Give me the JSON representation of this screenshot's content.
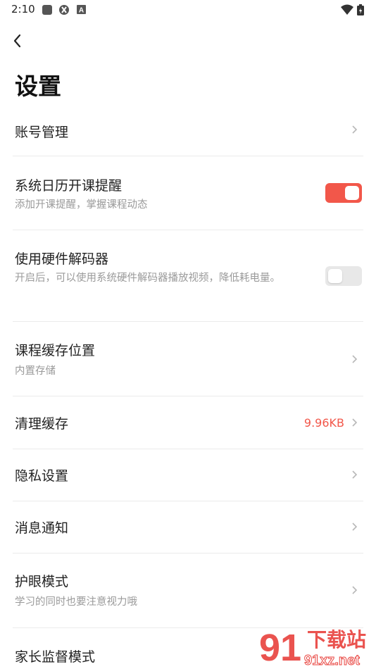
{
  "status_bar": {
    "time": "2:10",
    "left_icons": [
      "square-icon",
      "gesture-icon",
      "a-icon"
    ],
    "right_icons": [
      "wifi-icon",
      "battery-icon"
    ]
  },
  "header": {
    "back_icon": "chevron-left-icon",
    "title": "设置"
  },
  "settings": {
    "account": {
      "title": "账号管理"
    },
    "calendar_reminder": {
      "title": "系统日历开课提醒",
      "subtitle": "添加开课提醒，掌握课程动态",
      "enabled": true
    },
    "hardware_decoder": {
      "title": "使用硬件解码器",
      "subtitle": "开启后，可以使用系统硬件解码器播放视频，降低耗电量。",
      "enabled": false
    },
    "cache_location": {
      "title": "课程缓存位置",
      "subtitle": "内置存储"
    },
    "clear_cache": {
      "title": "清理缓存",
      "value": "9.96KB"
    },
    "privacy": {
      "title": "隐私设置"
    },
    "notifications": {
      "title": "消息通知"
    },
    "eye_care": {
      "title": "护眼模式",
      "subtitle": "学习的同时也要注意视力哦"
    },
    "parental": {
      "title": "家长监督模式"
    }
  },
  "watermark": {
    "text": "下载站",
    "url_text": "91xz.net"
  },
  "colors": {
    "accent": "#f2574a",
    "subtitle": "#9a9a9a",
    "divider": "#ebebeb"
  }
}
